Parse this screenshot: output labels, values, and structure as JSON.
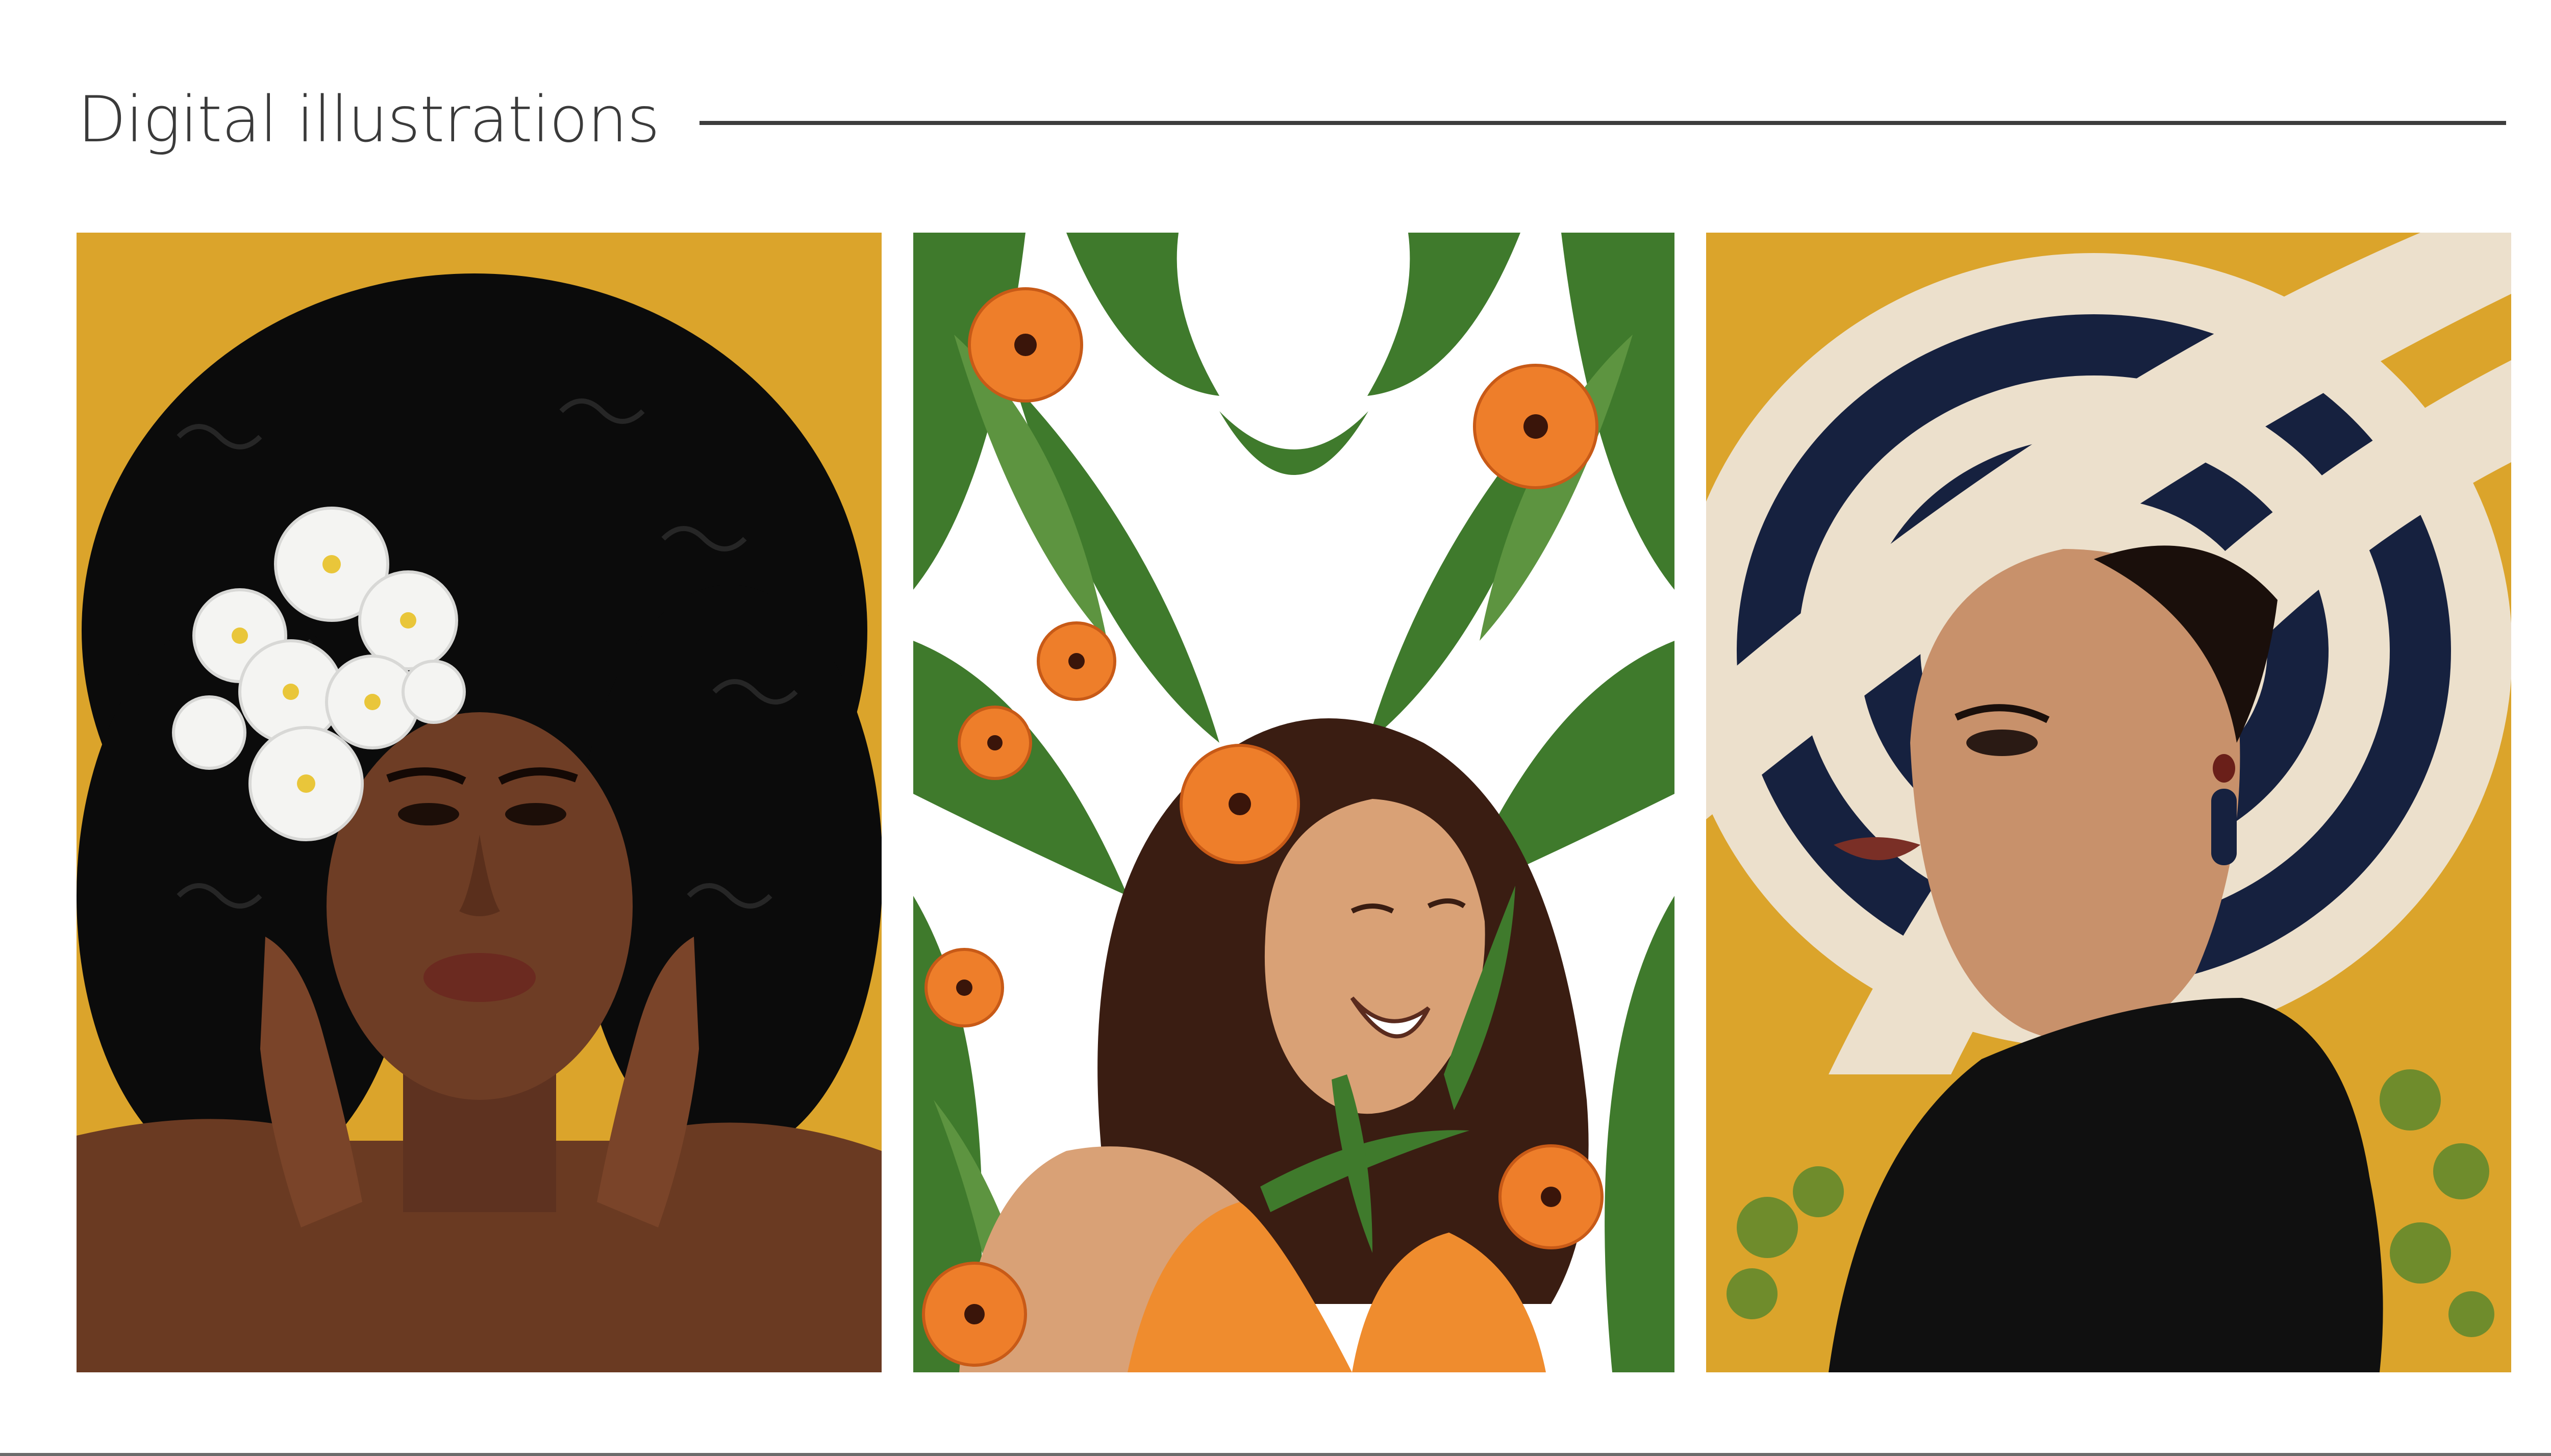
{
  "section": {
    "title": "Digital illustrations"
  },
  "illustrations": [
    {
      "icon": "afro-woman-white-flowers-illustration",
      "background_color": "#DBA42B"
    },
    {
      "icon": "smiling-woman-orange-flowers-illustration",
      "background_color": "#FFFFFF"
    },
    {
      "icon": "woman-striped-hat-illustration",
      "background_color": "#DBA42B"
    }
  ],
  "colors": {
    "mustard": "#DBA42B",
    "leaf_green": "#3F7A2C",
    "flower_orange": "#EE7E2A",
    "hat_navy": "#16213F",
    "hat_cream": "#ECE0CC"
  }
}
